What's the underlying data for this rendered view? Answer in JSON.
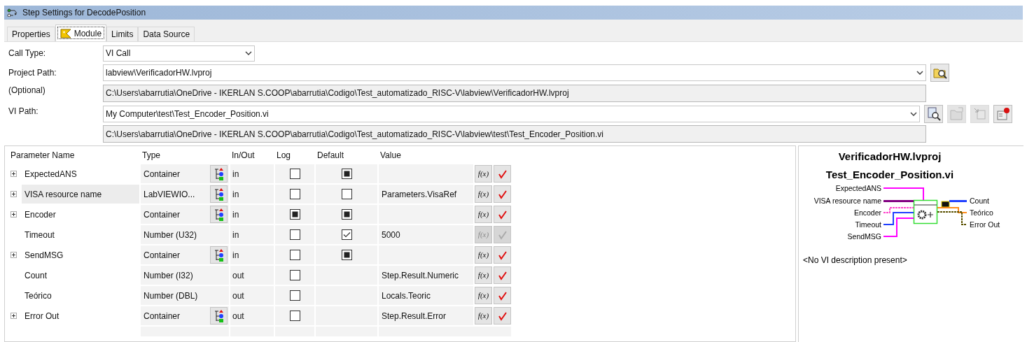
{
  "window": {
    "title": "Step Settings for DecodePosition"
  },
  "tabs": [
    {
      "label": "Properties",
      "selected": false,
      "icon": false
    },
    {
      "label": "Module",
      "selected": true,
      "icon": true
    },
    {
      "label": "Limits",
      "selected": false,
      "icon": false
    },
    {
      "label": "Data Source",
      "selected": false,
      "icon": false
    }
  ],
  "form": {
    "call_type_label": "Call Type:",
    "call_type": "VI Call",
    "project_path_label": "Project Path:",
    "project_path": "labview\\VerificadorHW.lvproj",
    "optional_label": "(Optional)",
    "project_full_path": "C:\\Users\\abarrutia\\OneDrive - IKERLAN S.COOP\\abarrutia\\Codigo\\Test_automatizado_RISC-V\\labview\\VerificadorHW.lvproj",
    "vi_path_label": "VI Path:",
    "vi_path": "My Computer\\test\\Test_Encoder_Position.vi",
    "vi_full_path": "C:\\Users\\abarrutia\\OneDrive - IKERLAN S.COOP\\abarrutia\\Codigo\\Test_automatizado_RISC-V\\labview\\test\\Test_Encoder_Position.vi",
    "vi_buttons": [
      {
        "kind": "browse",
        "disabled": false
      },
      {
        "kind": "edit",
        "disabled": true
      },
      {
        "kind": "reload",
        "disabled": true
      },
      {
        "kind": "run",
        "disabled": false
      }
    ]
  },
  "table": {
    "columns": [
      "Parameter Name",
      "Type",
      "In/Out",
      "Log",
      "Default",
      "Value"
    ],
    "rows": [
      {
        "name": "ExpectedANS",
        "expandable": true,
        "selected": false,
        "type": "Container",
        "type_icon": true,
        "inout": "in",
        "log": false,
        "default_filled": true,
        "default_checked": false,
        "value": "",
        "fx": "f(x)",
        "disabled": false
      },
      {
        "name": "VISA resource name",
        "expandable": true,
        "selected": true,
        "type": "LabVIEWIO...",
        "type_icon": true,
        "inout": "in",
        "log": false,
        "default_filled": false,
        "default_checked": false,
        "value": "Parameters.VisaRef",
        "fx": "f(x)",
        "disabled": false
      },
      {
        "name": "Encoder",
        "expandable": true,
        "selected": false,
        "type": "Container",
        "type_icon": true,
        "inout": "in",
        "log": true,
        "default_filled": true,
        "default_checked": false,
        "value": "",
        "fx": "f(x)",
        "disabled": false
      },
      {
        "name": "Timeout",
        "expandable": false,
        "selected": false,
        "type": "Number (U32)",
        "type_icon": false,
        "inout": "in",
        "log": false,
        "default_filled": false,
        "default_checked": true,
        "value": "5000",
        "fx": "f(x)",
        "disabled": true
      },
      {
        "name": "SendMSG",
        "expandable": true,
        "selected": false,
        "type": "Container",
        "type_icon": true,
        "inout": "in",
        "log": false,
        "default_filled": true,
        "default_checked": false,
        "value": "",
        "fx": "f(x)",
        "disabled": false
      },
      {
        "name": "Count",
        "expandable": false,
        "selected": false,
        "type": "Number (I32)",
        "type_icon": false,
        "inout": "out",
        "log": false,
        "value": "Step.Result.Numeric",
        "fx": "f(x)",
        "disabled": false
      },
      {
        "name": "Teórico",
        "expandable": false,
        "selected": false,
        "type": "Number (DBL)",
        "type_icon": false,
        "inout": "out",
        "log": false,
        "value": "Locals.Teoric",
        "fx": "f(x)",
        "disabled": false
      },
      {
        "name": "Error Out",
        "expandable": true,
        "selected": false,
        "type": "Container",
        "type_icon": true,
        "inout": "out",
        "log": false,
        "value": "Step.Result.Error",
        "fx": "f(x)",
        "disabled": false
      }
    ]
  },
  "preview": {
    "project": "VerificadorHW.lvproj",
    "vi": "Test_Encoder_Position.vi",
    "inputs": [
      {
        "label": "ExpectedANS",
        "color": "#ff00ff"
      },
      {
        "label": "VISA resource name",
        "color": "#800080"
      },
      {
        "label": "Encoder",
        "color": "#ff44cc"
      },
      {
        "label": "Timeout",
        "color": "#1f3fff"
      },
      {
        "label": "SendMSG",
        "color": "#ff00ff"
      }
    ],
    "outputs": [
      {
        "label": "Count",
        "color": "#1f3fff"
      },
      {
        "label": "Teórico",
        "color": "#ff8c1a"
      },
      {
        "label": "Error Out",
        "color": "#5a5000"
      }
    ],
    "description": "<No VI description present>"
  }
}
